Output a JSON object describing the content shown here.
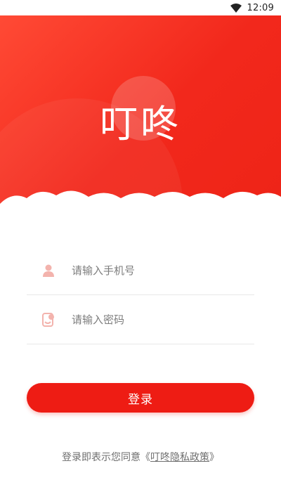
{
  "status_bar": {
    "time": "12:09"
  },
  "hero": {
    "logo_text": "叮咚"
  },
  "form": {
    "phone": {
      "placeholder": "请输入手机号",
      "value": ""
    },
    "password": {
      "placeholder": "请输入密码",
      "value": ""
    }
  },
  "actions": {
    "login_label": "登录"
  },
  "agreement": {
    "prefix": "登录即表示您同意",
    "open_quote": "《",
    "policy_link": "叮咚隐私政策",
    "close_quote": "》"
  },
  "colors": {
    "brand_red": "#ee1c14",
    "hero_gradient_start": "#ff4a35",
    "icon_tint": "#f3b3ad"
  },
  "icons": [
    "wifi-icon",
    "user-icon",
    "lock-phone-icon"
  ]
}
